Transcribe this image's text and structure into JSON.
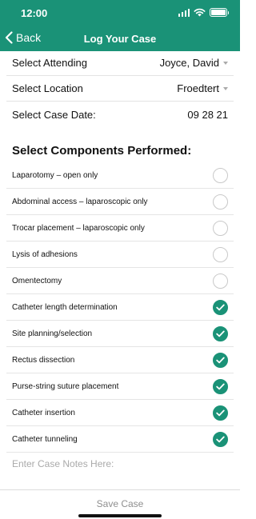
{
  "status_bar": {
    "time": "12:00"
  },
  "nav": {
    "back_label": "Back",
    "title": "Log Your Case"
  },
  "fields": [
    {
      "label": "Select Attending",
      "value": "Joyce, David",
      "dropdown": true
    },
    {
      "label": "Select Location",
      "value": "Froedtert",
      "dropdown": true
    },
    {
      "label": "Select Case Date:",
      "value": "09 28 21",
      "dropdown": false
    }
  ],
  "components_title": "Select Components Performed:",
  "components": [
    {
      "label": "Laparotomy – open only",
      "checked": false
    },
    {
      "label": "Abdominal access – laparoscopic only",
      "checked": false
    },
    {
      "label": "Trocar placement – laparoscopic only",
      "checked": false
    },
    {
      "label": "Lysis of adhesions",
      "checked": false
    },
    {
      "label": "Omentectomy",
      "checked": false
    },
    {
      "label": "Catheter length determination",
      "checked": true
    },
    {
      "label": "Site planning/selection",
      "checked": true
    },
    {
      "label": "Rectus dissection",
      "checked": true
    },
    {
      "label": "Purse-string suture placement",
      "checked": true
    },
    {
      "label": "Catheter insertion",
      "checked": true
    },
    {
      "label": "Catheter tunneling",
      "checked": true
    }
  ],
  "notes": {
    "placeholder": "Enter Case Notes Here:",
    "value": ""
  },
  "save_label": "Save Case",
  "colors": {
    "accent": "#1a9277",
    "unchecked_border": "#c9c9c9"
  }
}
